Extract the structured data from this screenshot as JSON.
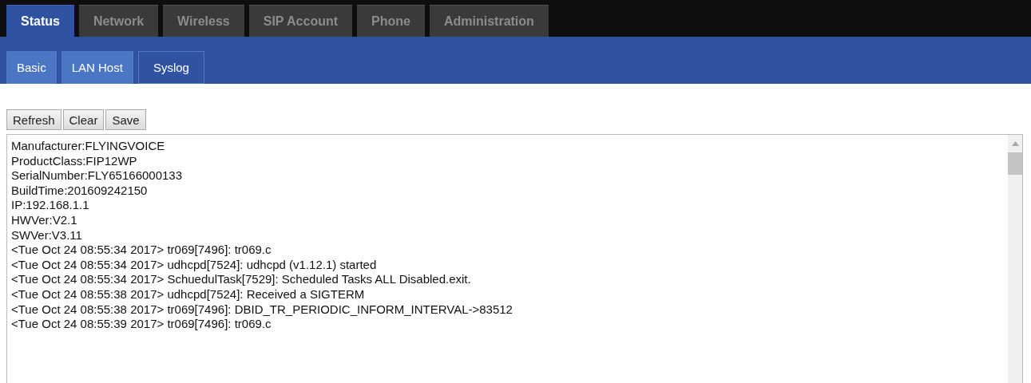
{
  "tabs": [
    {
      "label": "Status",
      "selected": true
    },
    {
      "label": "Network",
      "selected": false
    },
    {
      "label": "Wireless",
      "selected": false
    },
    {
      "label": "SIP Account",
      "selected": false
    },
    {
      "label": "Phone",
      "selected": false
    },
    {
      "label": "Administration",
      "selected": false
    }
  ],
  "subtabs": [
    {
      "label": "Basic",
      "selected": false
    },
    {
      "label": "LAN Host",
      "selected": false
    },
    {
      "label": "Syslog",
      "selected": true
    }
  ],
  "buttons": [
    "Refresh",
    "Clear",
    "Save"
  ],
  "log_lines": [
    "Manufacturer:FLYINGVOICE",
    "ProductClass:FIP12WP",
    "SerialNumber:FLY65166000133",
    "BuildTime:201609242150",
    "IP:192.168.1.1",
    "HWVer:V2.1",
    "SWVer:V3.11",
    "<Tue Oct 24 08:55:34 2017> tr069[7496]: tr069.c",
    "<Tue Oct 24 08:55:34 2017> udhcpd[7524]: udhcpd (v1.12.1) started",
    "<Tue Oct 24 08:55:34 2017> SchuedulTask[7529]: Scheduled Tasks ALL Disabled.exit.",
    "<Tue Oct 24 08:55:38 2017> udhcpd[7524]: Received a SIGTERM",
    "<Tue Oct 24 08:55:38 2017> tr069[7496]: DBID_TR_PERIODIC_INFORM_INTERVAL->83512",
    "<Tue Oct 24 08:55:39 2017> tr069[7496]: tr069.c"
  ]
}
